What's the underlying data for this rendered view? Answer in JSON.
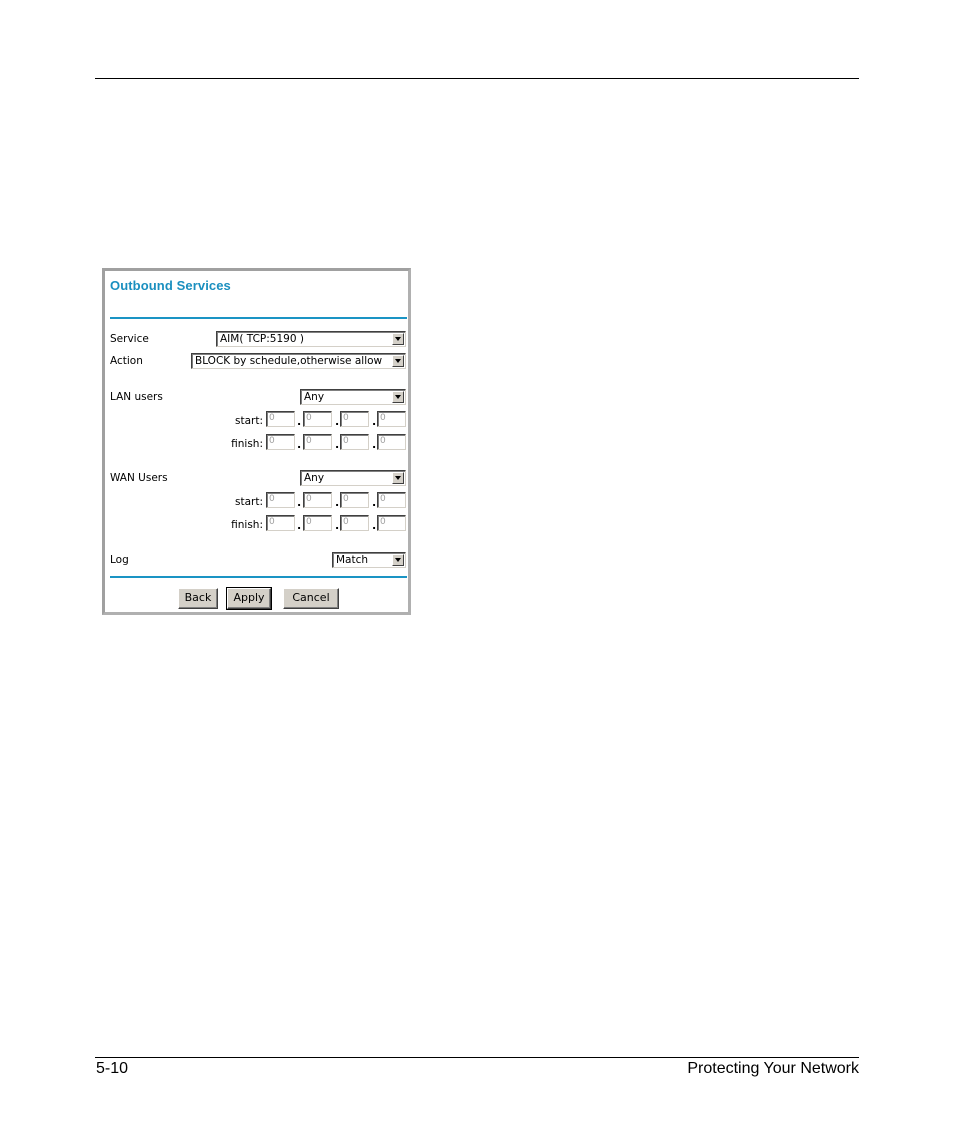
{
  "footer": {
    "page_number": "5-10",
    "section_title": "Protecting Your Network"
  },
  "panel": {
    "title": "Outbound Services",
    "accent_color": "#1a94c4",
    "service": {
      "label": "Service",
      "value": "AIM( TCP:5190 )"
    },
    "action": {
      "label": "Action",
      "value": "BLOCK by schedule,otherwise allow"
    },
    "lan_users": {
      "label": "LAN users",
      "value": "Any",
      "start_label": "start:",
      "finish_label": "finish:",
      "start": [
        "0",
        "0",
        "0",
        "0"
      ],
      "finish": [
        "0",
        "0",
        "0",
        "0"
      ]
    },
    "wan_users": {
      "label": "WAN Users",
      "value": "Any",
      "start_label": "start:",
      "finish_label": "finish:",
      "start": [
        "0",
        "0",
        "0",
        "0"
      ],
      "finish": [
        "0",
        "0",
        "0",
        "0"
      ]
    },
    "log": {
      "label": "Log",
      "value": "Match"
    },
    "buttons": {
      "back": "Back",
      "apply": "Apply",
      "cancel": "Cancel"
    }
  }
}
